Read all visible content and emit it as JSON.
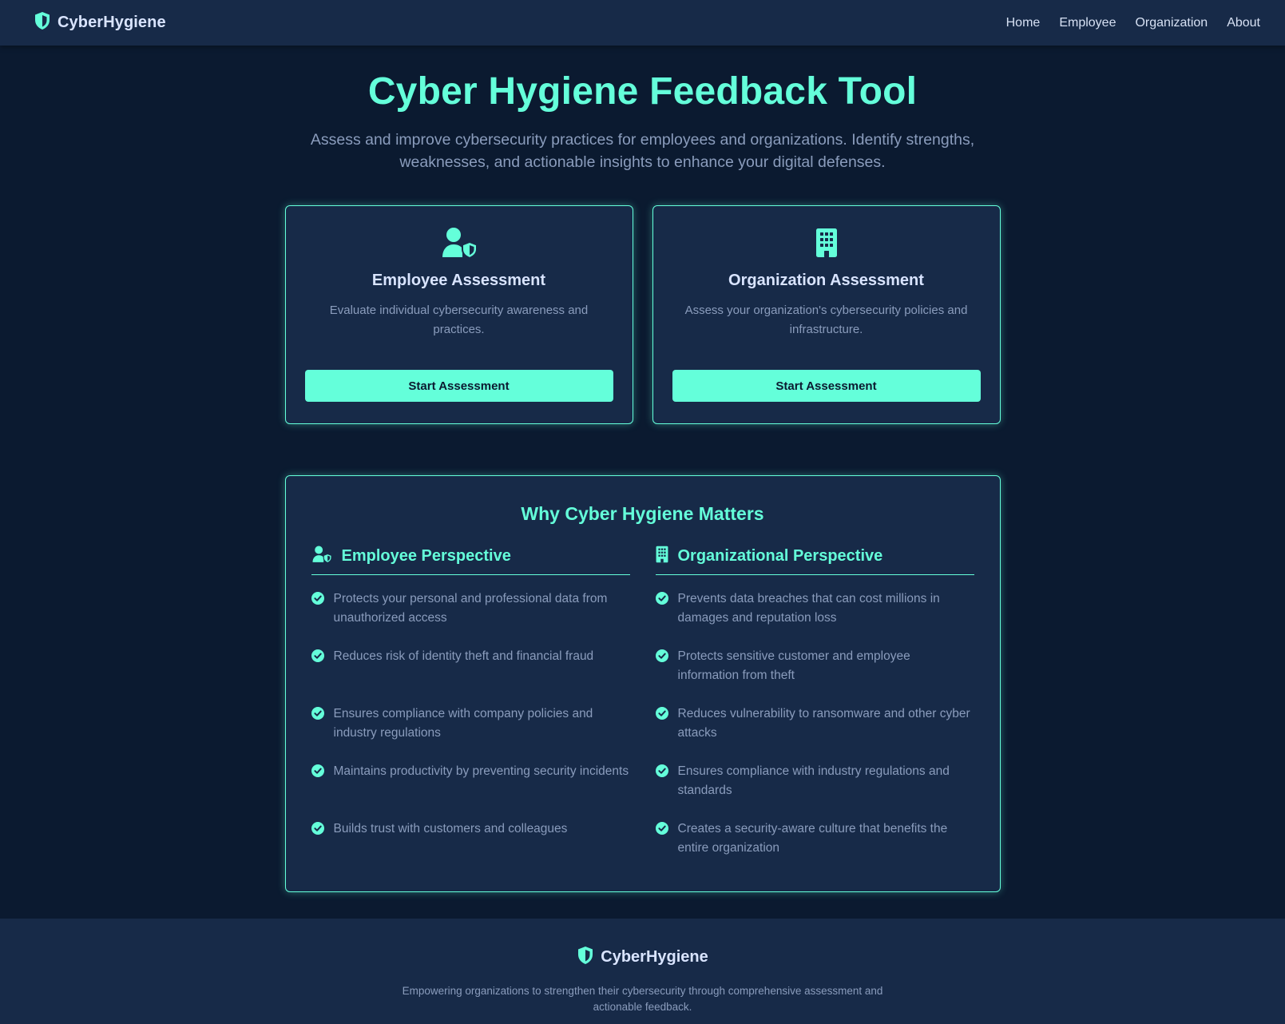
{
  "nav": {
    "brand": "CyberHygiene",
    "links": [
      "Home",
      "Employee",
      "Organization",
      "About"
    ]
  },
  "hero": {
    "title": "Cyber Hygiene Feedback Tool",
    "subtitle": "Assess and improve cybersecurity practices for employees and organizations. Identify strengths, weaknesses, and actionable insights to enhance your digital defenses."
  },
  "cards": [
    {
      "icon": "user-shield-icon",
      "title": "Employee Assessment",
      "description": "Evaluate individual cybersecurity awareness and practices.",
      "button": "Start Assessment"
    },
    {
      "icon": "building-icon",
      "title": "Organization Assessment",
      "description": "Assess your organization's cybersecurity policies and infrastructure.",
      "button": "Start Assessment"
    }
  ],
  "why": {
    "title": "Why Cyber Hygiene Matters",
    "employee": {
      "icon": "user-shield-icon",
      "title": "Employee Perspective",
      "items": [
        "Protects your personal and professional data from unauthorized access",
        "Reduces risk of identity theft and financial fraud",
        "Ensures compliance with company policies and industry regulations",
        "Maintains productivity by preventing security incidents",
        "Builds trust with customers and colleagues"
      ]
    },
    "organization": {
      "icon": "building-icon",
      "title": "Organizational Perspective",
      "items": [
        "Prevents data breaches that can cost millions in damages and reputation loss",
        "Protects sensitive customer and employee information from theft",
        "Reduces vulnerability to ransomware and other cyber attacks",
        "Ensures compliance with industry regulations and standards",
        "Creates a security-aware culture that benefits the entire organization"
      ]
    }
  },
  "footer": {
    "brand": "CyberHygiene",
    "text": "Empowering organizations to strengthen their cybersecurity through comprehensive assessment and actionable feedback."
  },
  "colors": {
    "accent": "#64ffda",
    "background": "#0b1a30",
    "surface": "#172a48",
    "muted_text": "#8a9cbc"
  }
}
